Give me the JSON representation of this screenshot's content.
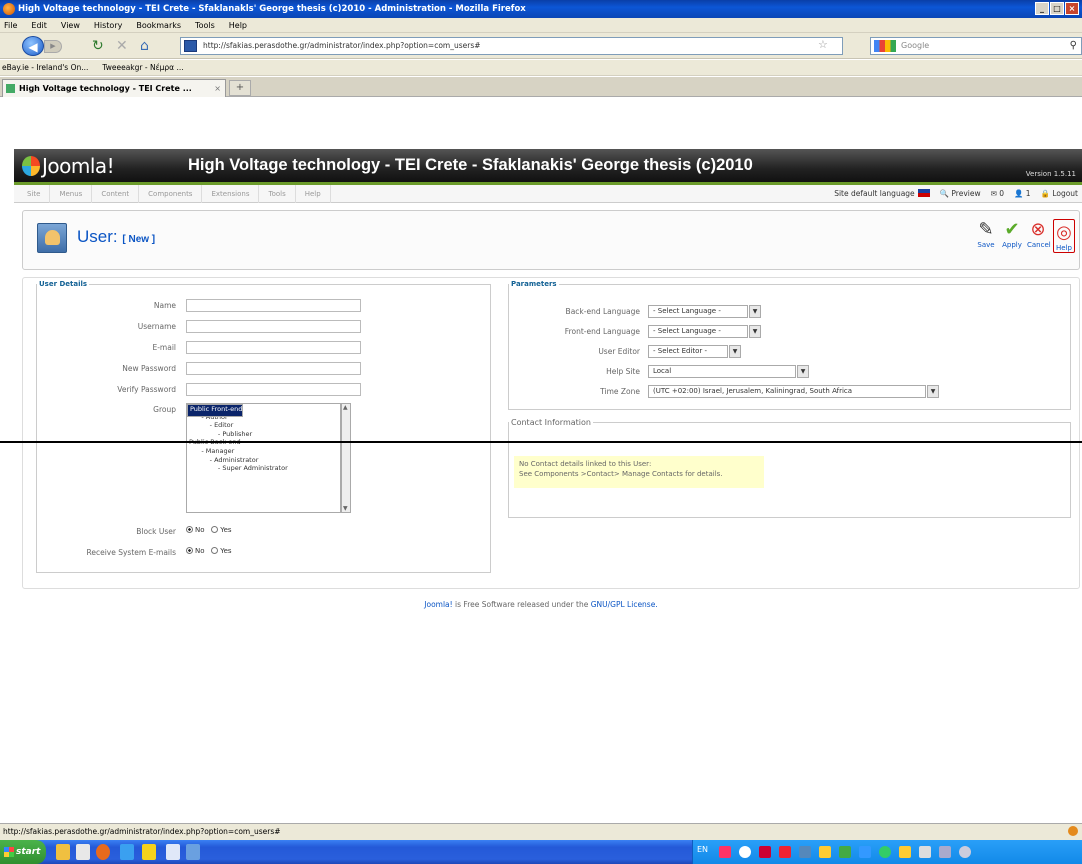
{
  "window": {
    "title": "High Voltage technology - TEI Crete - Sfaklanakls' George thesis (c)2010 - Administration - Mozilla Firefox"
  },
  "menubar": [
    "File",
    "Edit",
    "View",
    "History",
    "Bookmarks",
    "Tools",
    "Help"
  ],
  "navbar": {
    "url": "http://sfakias.perasdothe.gr/administrator/index.php?option=com_users#",
    "search_placeholder": "Google"
  },
  "bookmarks": [
    "eBay.ie - Ireland's On...",
    "Tweeeakgr - Nέμρα ..."
  ],
  "tab": {
    "label": "High Voltage technology - TEI Crete ..."
  },
  "joomla": {
    "logo": "Joomla!",
    "site_title": "High Voltage technology - TEI Crete - Sfaklanakis' George thesis (c)2010",
    "version": "Version 1.5.11",
    "menu": [
      "Site",
      "Menus",
      "Content",
      "Components",
      "Extensions",
      "Tools",
      "Help"
    ],
    "status": {
      "language": "Site default language",
      "preview": "Preview",
      "messages": "0",
      "users": "1",
      "logout": "Logout"
    }
  },
  "toolbar": {
    "heading": "User:",
    "heading_sub": "[ New ]",
    "buttons": [
      {
        "label": "Save",
        "icon": "save-icon"
      },
      {
        "label": "Apply",
        "icon": "apply-icon"
      },
      {
        "label": "Cancel",
        "icon": "cancel-icon"
      },
      {
        "label": "Help",
        "icon": "help-icon"
      }
    ]
  },
  "user_details": {
    "legend": "User Details",
    "labels": {
      "name": "Name",
      "username": "Username",
      "email": "E-mail",
      "new_password": "New Password",
      "verify_password": "Verify Password",
      "group": "Group",
      "block_user": "Block User",
      "receive_email": "Receive System E-mails"
    },
    "groups": [
      "Public Front-end",
      "- Registered",
      "      - Author",
      "          - Editor",
      "              - Publisher",
      "Public Back-end",
      "      - Manager",
      "          - Administrator",
      "              - Super Administrator"
    ],
    "no": "No",
    "yes": "Yes"
  },
  "parameters": {
    "legend": "Parameters",
    "labels": {
      "backend_language": "Back-end Language",
      "frontend_language": "Front-end Language",
      "user_editor": "User Editor",
      "help_site": "Help Site",
      "time_zone": "Time Zone"
    },
    "values": {
      "backend_language": "- Select Language -",
      "frontend_language": "- Select Language -",
      "user_editor": "- Select Editor -",
      "help_site": "Local",
      "time_zone": "(UTC +02:00) Israel, Jerusalem, Kaliningrad, South Africa"
    }
  },
  "contact": {
    "legend": "Contact Information",
    "line1": "No Contact details linked to this User:",
    "line2": "See Components >Contact> Manage Contacts for details."
  },
  "footer": {
    "link": "Joomla!",
    "text": " is Free Software released under the ",
    "license": "GNU/GPL License."
  },
  "statusbar": {
    "text": "http://sfakias.perasdothe.gr/administrator/index.php?option=com_users#"
  },
  "taskbar": {
    "start": "start",
    "lang": "EN"
  }
}
